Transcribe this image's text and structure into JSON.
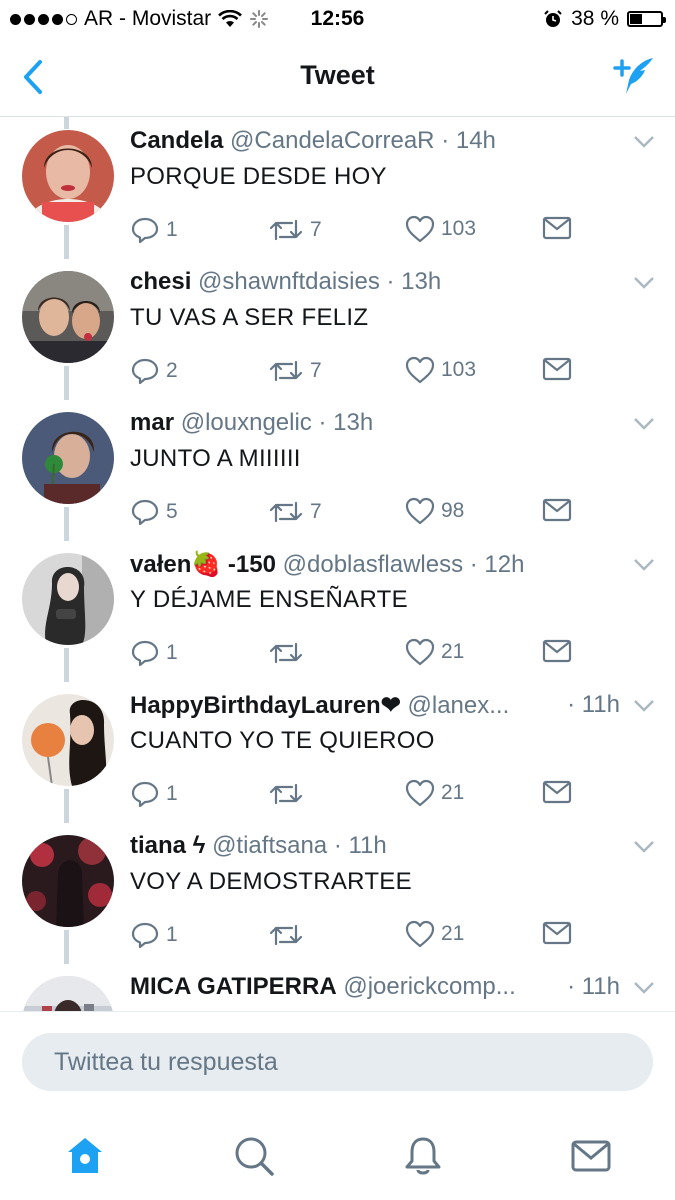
{
  "status_bar": {
    "carrier": "AR - Movistar",
    "time": "12:56",
    "battery": "38 %",
    "battery_level": 0.38
  },
  "nav": {
    "title": "Tweet",
    "back_icon": "chevron-left-icon",
    "compose_icon": "compose-tweet-icon"
  },
  "colors": {
    "accent": "#1da1f2",
    "secondary_text": "#657786",
    "thread_line": "#ccd6dd"
  },
  "tweets": [
    {
      "name": "Candela",
      "handle": "@CandelaCorreaR",
      "time": "· 14h",
      "text": "PORQUE DESDE HOY",
      "replies": "1",
      "retweets": "7",
      "likes": "103"
    },
    {
      "name": "chesi",
      "handle": "@shawnftdaisies",
      "time": "· 13h",
      "text": "TU VAS A SER FELIZ",
      "replies": "2",
      "retweets": "7",
      "likes": "103"
    },
    {
      "name": "mar",
      "handle": "@louxngelic",
      "time": "· 13h",
      "text": "JUNTO A MIIIIII",
      "replies": "5",
      "retweets": "7",
      "likes": "98"
    },
    {
      "name": "vałen🍓 -150",
      "handle": "@doblasflawless",
      "time": "· 12h",
      "text": "Y DÉJAME ENSEÑARTE",
      "replies": "1",
      "retweets": "",
      "likes": "21"
    },
    {
      "name": "HappyBirthdayLauren❤",
      "handle": "@lanex...",
      "time": "· 11h",
      "text": "CUANTO YO TE QUIEROO",
      "replies": "1",
      "retweets": "",
      "likes": "21"
    },
    {
      "name": "tiana ϟ",
      "handle": "@tiaftsana",
      "time": "· 11h",
      "text": "VOY A DEMOSTRARTEE",
      "replies": "1",
      "retweets": "",
      "likes": "21"
    },
    {
      "name": "MICA GATIPERRA",
      "handle": "@joerickcomp...",
      "time": "· 11h",
      "text": "",
      "replies": "",
      "retweets": "",
      "likes": ""
    }
  ],
  "reply_box": {
    "placeholder": "Twittea tu respuesta"
  },
  "tabbar": {
    "items": [
      "home-icon",
      "search-icon",
      "notifications-icon",
      "messages-icon"
    ],
    "active": "home-icon"
  }
}
